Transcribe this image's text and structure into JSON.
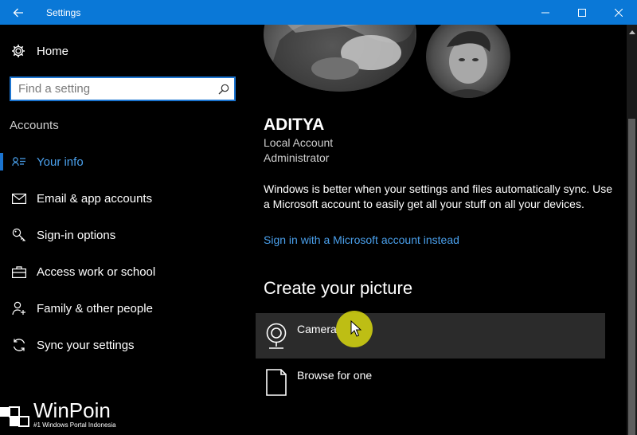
{
  "window": {
    "title": "Settings"
  },
  "sidebar": {
    "home_label": "Home",
    "search_placeholder": "Find a setting",
    "section_label": "Accounts",
    "items": [
      {
        "label": "Your info",
        "icon": "person-card-icon",
        "active": true
      },
      {
        "label": "Email & app accounts",
        "icon": "mail-icon",
        "active": false
      },
      {
        "label": "Sign-in options",
        "icon": "key-icon",
        "active": false
      },
      {
        "label": "Access work or school",
        "icon": "briefcase-icon",
        "active": false
      },
      {
        "label": "Family & other people",
        "icon": "add-person-icon",
        "active": false
      },
      {
        "label": "Sync your settings",
        "icon": "sync-icon",
        "active": false
      }
    ]
  },
  "profile": {
    "name": "ADITYA",
    "account_type": "Local Account",
    "role": "Administrator"
  },
  "sync_message": "Windows is better when your settings and files automatically sync. Use a Microsoft account to easily get all your stuff on all your devices.",
  "signin_link": "Sign in with a Microsoft account instead",
  "create_picture": {
    "heading": "Create your picture",
    "options": [
      {
        "label": "Camera",
        "icon": "webcam-icon"
      },
      {
        "label": "Browse for one",
        "icon": "file-icon"
      }
    ]
  },
  "watermark": {
    "title": "WinPoin",
    "tagline": "#1 Windows Portal Indonesia"
  },
  "colors": {
    "accent": "#0a78d7",
    "link": "#4aa0ec",
    "background": "#000000",
    "selected_row": "#2b2b2b",
    "cursor_highlight": "#cece12"
  }
}
